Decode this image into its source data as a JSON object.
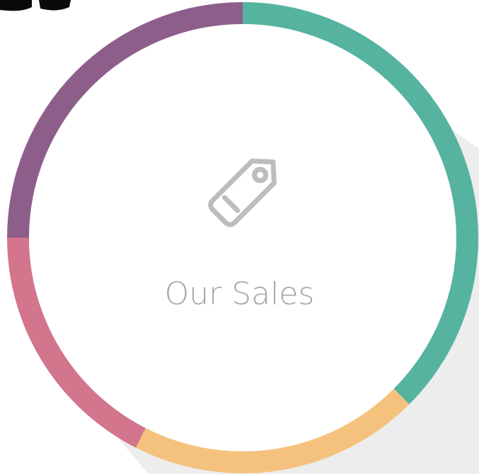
{
  "chart_data": {
    "type": "pie",
    "style": "donut",
    "center_label": "Our Sales",
    "center_icon": "tag-icon",
    "segments": [
      {
        "share_percent": 37.5,
        "color": "#55B3A0"
      },
      {
        "share_percent": 20.0,
        "color": "#F5C27D"
      },
      {
        "share_percent": 17.5,
        "color": "#D3758D"
      },
      {
        "share_percent": 25.0,
        "color": "#8E5E8B"
      }
    ]
  },
  "colors": {
    "label_text": "#A6A6A6",
    "icon_stroke": "#BDBDBD",
    "shadow": "#EDEDED",
    "corner_glyph": "#0A0A0A"
  }
}
